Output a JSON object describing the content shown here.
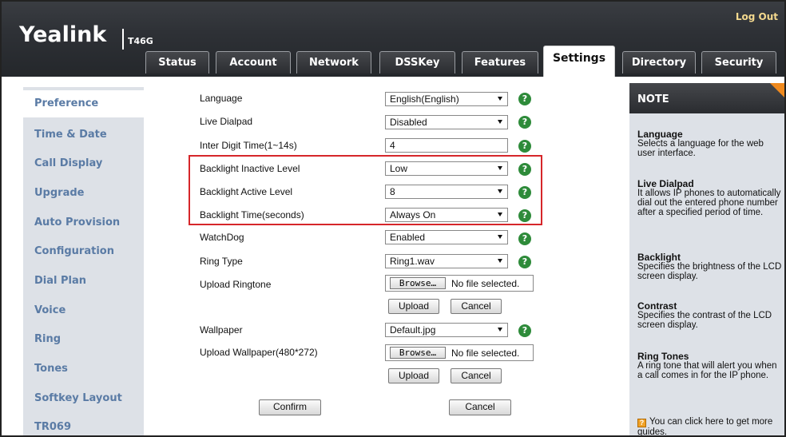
{
  "header": {
    "logo": "Yealink",
    "model": "T46G",
    "logout": "Log Out"
  },
  "tabs": [
    {
      "label": "Status",
      "active": false
    },
    {
      "label": "Account",
      "active": false
    },
    {
      "label": "Network",
      "active": false
    },
    {
      "label": "DSSKey",
      "active": false
    },
    {
      "label": "Features",
      "active": false
    },
    {
      "label": "Settings",
      "active": true
    },
    {
      "label": "Directory",
      "active": false
    },
    {
      "label": "Security",
      "active": false
    }
  ],
  "sidebar": {
    "items": [
      {
        "label": "Preference",
        "active": true
      },
      {
        "label": "Time & Date",
        "active": false
      },
      {
        "label": "Call Display",
        "active": false
      },
      {
        "label": "Upgrade",
        "active": false
      },
      {
        "label": "Auto Provision",
        "active": false
      },
      {
        "label": "Configuration",
        "active": false
      },
      {
        "label": "Dial Plan",
        "active": false
      },
      {
        "label": "Voice",
        "active": false
      },
      {
        "label": "Ring",
        "active": false
      },
      {
        "label": "Tones",
        "active": false
      },
      {
        "label": "Softkey Layout",
        "active": false
      },
      {
        "label": "TR069",
        "active": false
      }
    ]
  },
  "form": {
    "language": {
      "label": "Language",
      "value": "English(English)"
    },
    "live_dialpad": {
      "label": "Live Dialpad",
      "value": "Disabled"
    },
    "inter_digit": {
      "label": "Inter Digit Time(1~14s)",
      "value": "4"
    },
    "backlight_inactive": {
      "label": "Backlight Inactive Level",
      "value": "Low"
    },
    "backlight_active": {
      "label": "Backlight Active Level",
      "value": "8"
    },
    "backlight_time": {
      "label": "Backlight Time(seconds)",
      "value": "Always On"
    },
    "watchdog": {
      "label": "WatchDog",
      "value": "Enabled"
    },
    "ring_type": {
      "label": "Ring Type",
      "value": "Ring1.wav"
    },
    "upload_ringtone": {
      "label": "Upload Ringtone",
      "browse": "Browse…",
      "nofile": "No file selected."
    },
    "wallpaper": {
      "label": "Wallpaper",
      "value": "Default.jpg"
    },
    "upload_wallpaper": {
      "label": "Upload Wallpaper(480*272)",
      "browse": "Browse…",
      "nofile": "No file selected."
    },
    "upload_btn": "Upload",
    "cancel_btn": "Cancel",
    "confirm_btn": "Confirm",
    "help_glyph": "?"
  },
  "note": {
    "title": "NOTE",
    "sections": [
      {
        "heading": "Language",
        "text": "Selects a language for the web user interface."
      },
      {
        "heading": "Live Dialpad",
        "text": "It allows IP phones to automatically dial out the entered phone number after a specified period of time."
      },
      {
        "heading": "Backlight",
        "text": "Specifies the brightness of the LCD screen display."
      },
      {
        "heading": "Contrast",
        "text": "Specifies the contrast of the LCD screen display."
      },
      {
        "heading": "Ring Tones",
        "text": "A ring tone that will alert you when a call comes in for the IP phone."
      }
    ],
    "tip": "You can click here to get more guides."
  },
  "colors": {
    "header_bg": "#2e3136",
    "nav_text": "#5a7ba5",
    "highlight": "#d6262a",
    "help_icon": "#2e8b3a",
    "note_corner": "#f08a1e",
    "logout": "#f4d98e"
  }
}
